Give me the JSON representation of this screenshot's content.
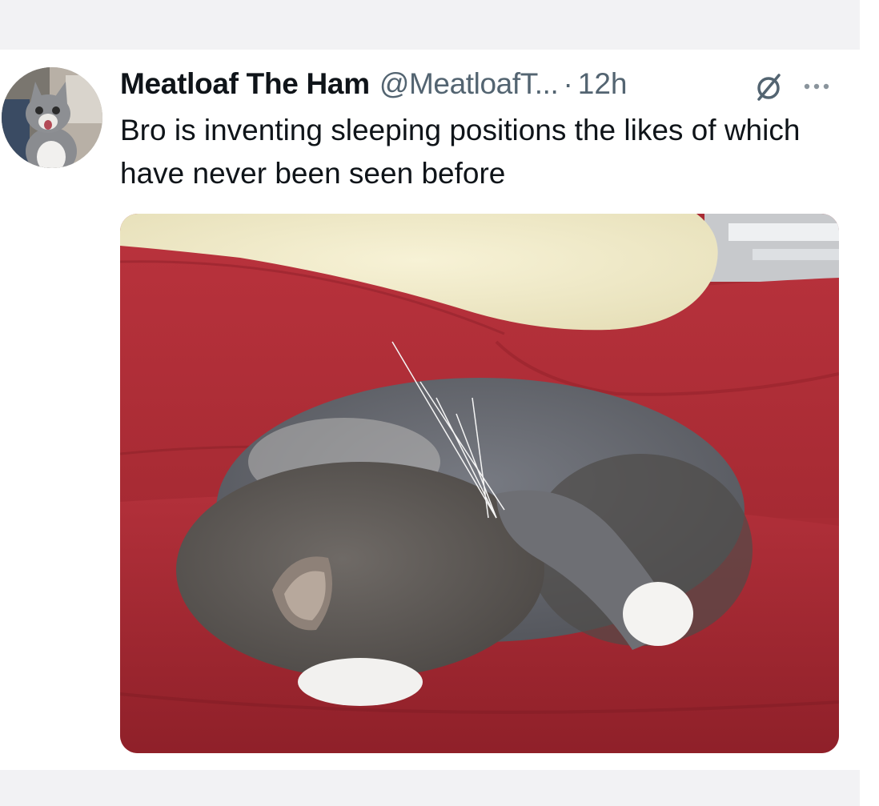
{
  "tweet": {
    "display_name": "Meatloaf The Ham",
    "handle": "@MeatloafT...",
    "separator": "·",
    "time": "12h",
    "text": "Bro is inventing sleeping positions the likes of which have never been seen before",
    "avatar_icon": "avatar-cat-photo",
    "grok_icon": "grok-icon",
    "more_icon": "more-dots-icon",
    "media": {
      "kind": "photo",
      "subject": "grey and white cat curled up asleep on a red couch with paw over face"
    }
  },
  "colors": {
    "text_primary": "#0f1419",
    "text_secondary": "#536471",
    "card_background": "#ffffff",
    "page_background": "#f2f2f4"
  }
}
